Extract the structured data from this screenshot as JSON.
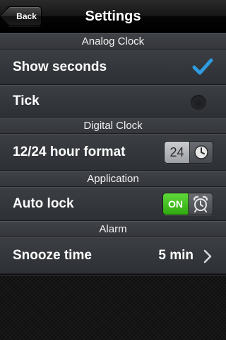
{
  "navbar": {
    "back_label": "Back",
    "title": "Settings"
  },
  "sections": {
    "analog": {
      "header": "Analog Clock",
      "show_seconds_label": "Show seconds",
      "show_seconds_checked": true,
      "tick_label": "Tick",
      "tick_selected": false
    },
    "digital": {
      "header": "Digital Clock",
      "format_label": "12/24 hour format",
      "format_value": "24"
    },
    "application": {
      "header": "Application",
      "auto_lock_label": "Auto lock",
      "auto_lock_state": "ON"
    },
    "alarm": {
      "header": "Alarm",
      "snooze_label": "Snooze time",
      "snooze_value": "5 min"
    }
  },
  "colors": {
    "check_blue": "#2f9be0",
    "toggle_green": "#3fbf1f"
  },
  "icons": [
    "chevron-left-icon",
    "checkmark-icon",
    "radio-icon",
    "clock-icon",
    "alarm-clock-icon",
    "chevron-right-icon"
  ]
}
